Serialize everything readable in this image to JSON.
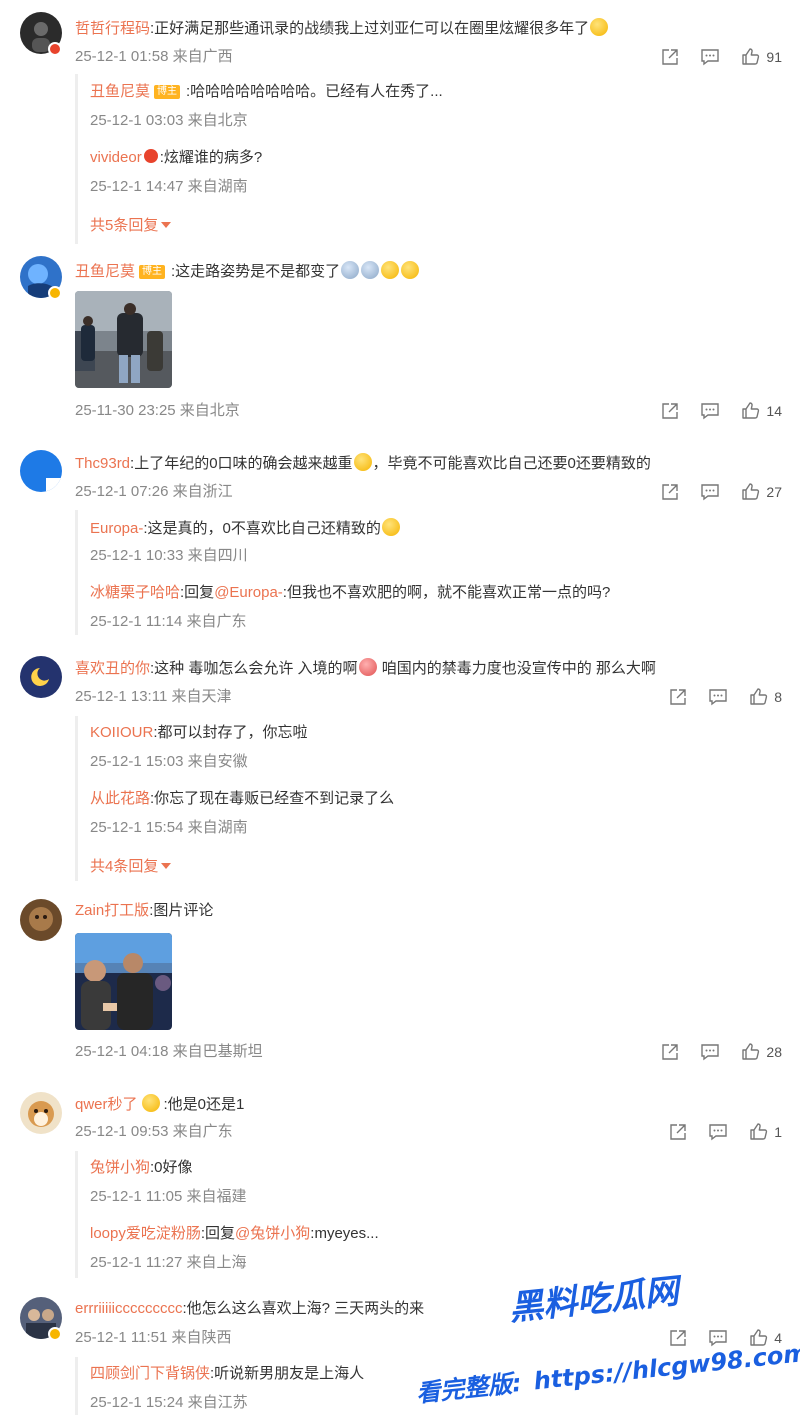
{
  "comments": [
    {
      "user": "哲哲行程码",
      "text": ":正好满足那些通讯录的战绩我上过刘亚仁可以在圈里炫耀很多年了",
      "meta": "25-12-1 01:58 来自广西",
      "likes": "91",
      "replies": [
        {
          "user": "丑鱼尼莫",
          "owner_tag": "博主",
          "text": ":哈哈哈哈哈哈哈哈。已经有人在秀了...",
          "meta": "25-12-1 03:03 来自北京"
        },
        {
          "user": "vivideor",
          "text": ":炫耀谁的病多?",
          "meta": "25-12-1 14:47 来自湖南"
        }
      ],
      "more": "共5条回复"
    },
    {
      "user": "丑鱼尼莫",
      "owner_tag": "博主",
      "text": ":这走路姿势是不是都变了",
      "meta": "25-11-30 23:25 来自北京",
      "likes": "14"
    },
    {
      "user": "Thc93rd",
      "text": ":上了年纪的0口味的确会越来越重",
      "text2": "，毕竟不可能喜欢比自己还要0还要精致的",
      "meta": "25-12-1 07:26 来自浙江",
      "likes": "27",
      "replies": [
        {
          "user": "Europa-",
          "text": ":这是真的，0不喜欢比自己还精致的",
          "meta": "25-12-1 10:33 来自四川"
        },
        {
          "user": "冰糖栗子哈哈",
          "text_prefix": ":回复",
          "mention": "@Europa-",
          "text": ":但我也不喜欢肥的啊，就不能喜欢正常一点的吗?",
          "meta": "25-12-1 11:14 来自广东"
        }
      ]
    },
    {
      "user": "喜欢丑的你",
      "text": ":这种 毒咖怎么会允许 入境的啊",
      "text2": " 咱国内的禁毒力度也没宣传中的 那么大啊",
      "meta": "25-12-1 13:11 来自天津",
      "likes": "8",
      "replies": [
        {
          "user": "KOIIOUR",
          "text": ":都可以封存了，你忘啦",
          "meta": "25-12-1 15:03 来自安徽"
        },
        {
          "user": "从此花路",
          "text": ":你忘了现在毒贩已经查不到记录了么",
          "meta": "25-12-1 15:54 来自湖南"
        }
      ],
      "more": "共4条回复"
    },
    {
      "user": "Zain打工版",
      "text": ":图片评论",
      "meta": "25-12-1 04:18 来自巴基斯坦",
      "likes": "28"
    },
    {
      "user": "qwer秒了",
      "text": ":他是0还是1",
      "meta": "25-12-1 09:53 来自广东",
      "likes": "1",
      "replies": [
        {
          "user": "兔饼小狗",
          "text": ":0好像",
          "meta": "25-12-1 11:05 来自福建"
        },
        {
          "user": "loopy爱吃淀粉肠",
          "text_prefix": ":回复",
          "mention": "@兔饼小狗",
          "text": ":myeyes...",
          "meta": "25-12-1 11:27 来自上海"
        }
      ]
    },
    {
      "user": "errriiiiiccccccccc",
      "text": ":他怎么这么喜欢上海? 三天两头的来",
      "meta": "25-12-1 11:51 来自陕西",
      "likes": "4",
      "replies": [
        {
          "user": "四顾剑门下背锅侠",
          "text": ":听说新男朋友是上海人",
          "meta": "25-12-1 15:24 来自江苏"
        }
      ]
    }
  ],
  "watermark": {
    "title": "黑料吃瓜网",
    "prefix": "看完整版:",
    "url": "https://hlcgw98.com"
  },
  "colors": {
    "username": "#eb7350",
    "meta": "#888888",
    "text": "#333333",
    "watermark": "#1a5fe0"
  },
  "icons": [
    "share-icon",
    "comment-icon",
    "like-icon"
  ]
}
